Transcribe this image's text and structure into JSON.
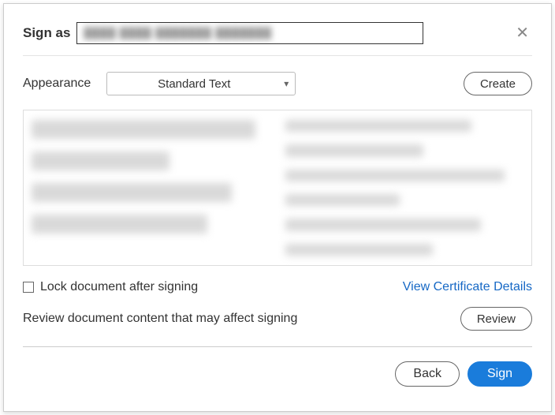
{
  "header": {
    "sign_as_label": "Sign as",
    "identity_redacted": "████ ████ ███████ ███████"
  },
  "appearance": {
    "label": "Appearance",
    "selected": "Standard Text",
    "create_label": "Create"
  },
  "lock": {
    "label": "Lock document after signing",
    "checked": false
  },
  "certificate_link": "View Certificate Details",
  "review": {
    "text": "Review document content that may affect signing",
    "button": "Review"
  },
  "footer": {
    "back": "Back",
    "sign": "Sign"
  }
}
